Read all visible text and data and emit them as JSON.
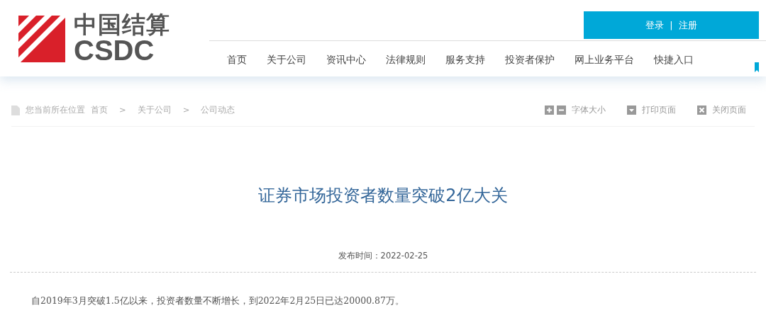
{
  "logo": {
    "name": "中国结算",
    "abbr": "CSDC"
  },
  "account": {
    "login": "登录",
    "divider": "|",
    "register": "注册"
  },
  "nav": [
    {
      "label": "首页"
    },
    {
      "label": "关于公司"
    },
    {
      "label": "资讯中心"
    },
    {
      "label": "法律规则"
    },
    {
      "label": "服务支持"
    },
    {
      "label": "投资者保护"
    },
    {
      "label": "网上业务平台"
    },
    {
      "label": "快捷入口"
    }
  ],
  "breadcrumb": {
    "prefix": "您当前所在位置",
    "items": [
      {
        "kind": "link",
        "text": "首页"
      },
      {
        "kind": "sep",
        "text": ">"
      },
      {
        "kind": "link",
        "text": "关于公司"
      },
      {
        "kind": "sep",
        "text": ">"
      },
      {
        "kind": "current",
        "text": "公司动态"
      }
    ]
  },
  "tools": [
    {
      "kind": "font",
      "text": "字体大小"
    },
    {
      "kind": "print",
      "text": "打印页面"
    },
    {
      "kind": "close",
      "text": "关闭页面"
    }
  ],
  "article": {
    "title": "证券市场投资者数量突破2亿大关",
    "date_label": "发布时间：",
    "date": "2022-02-25",
    "body": "自2019年3月突破1.5亿以来，投资者数量不断增长，到2022年2月25日已达20000.87万。"
  }
}
